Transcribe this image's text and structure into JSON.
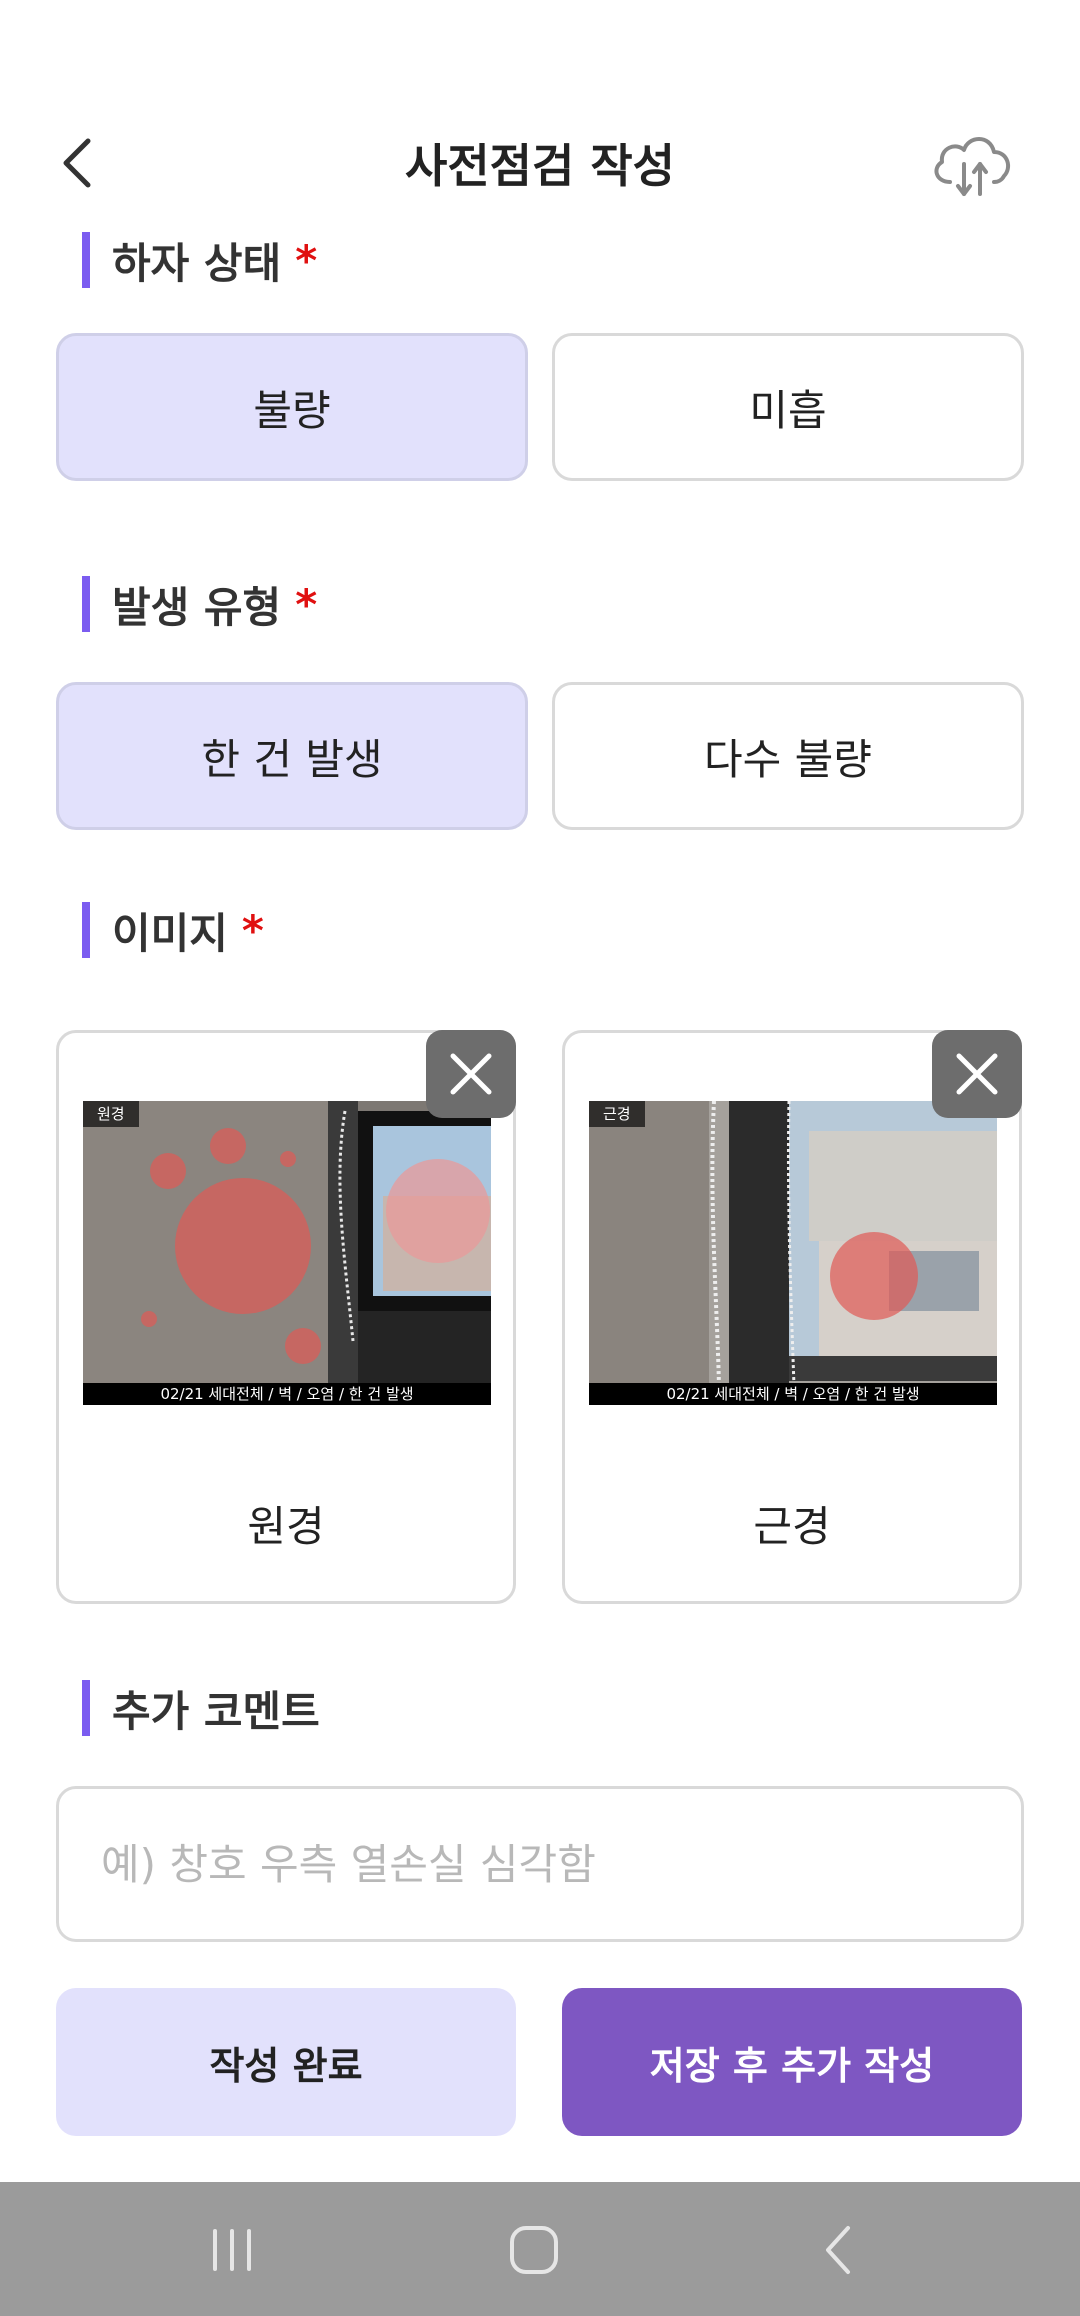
{
  "header": {
    "title": "사전점검 작성"
  },
  "sections": {
    "defect_state": {
      "label": "하자 상태",
      "required_mark": "*"
    },
    "occurrence_type": {
      "label": "발생 유형",
      "required_mark": "*"
    },
    "images": {
      "label": "이미지",
      "required_mark": "*"
    },
    "comment": {
      "label": "추가 코멘트"
    }
  },
  "defect_state_options": [
    {
      "label": "불량",
      "selected": true
    },
    {
      "label": "미흡",
      "selected": false
    }
  ],
  "occurrence_type_options": [
    {
      "label": "한 건 발생",
      "selected": true
    },
    {
      "label": "다수 불량",
      "selected": false
    }
  ],
  "images": [
    {
      "caption": "원경",
      "tag": "원경",
      "stamp": "02/21 세대전체 / 벽 / 오염 / 한 건 발생"
    },
    {
      "caption": "근경",
      "tag": "근경",
      "stamp": "02/21 세대전체 / 벽 / 오염 / 한 건 발생"
    }
  ],
  "comment": {
    "placeholder": "예) 창호 우측 열손실 심각함",
    "value": ""
  },
  "actions": {
    "done_label": "작성 완료",
    "save_add_label": "저장 후 추가 작성"
  },
  "colors": {
    "accent": "#7b5cf0",
    "selected_bg": "#e2e1fc",
    "primary_button": "#7e57c2",
    "required": "#e01010"
  },
  "icons": {
    "back": "chevron-left-icon",
    "cloud": "cloud-sync-icon",
    "close": "close-icon"
  }
}
